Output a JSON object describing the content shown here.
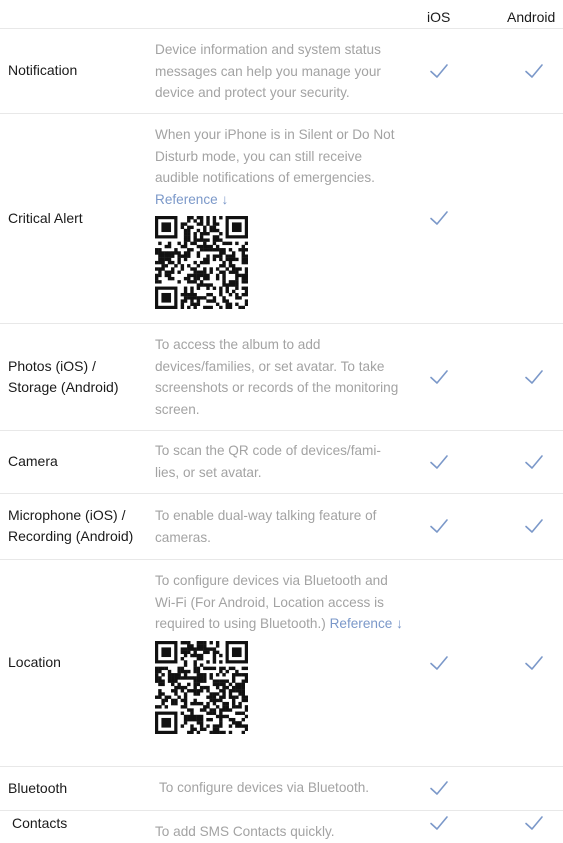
{
  "columns": {
    "ios": "iOS",
    "android": "Android"
  },
  "reference_label": "Reference",
  "reference_arrow": "↓",
  "colors": {
    "check": "#7b98c9",
    "text": "#1a1a1a",
    "description": "#a3a3a3",
    "divider": "#e8e8e8"
  },
  "rows": [
    {
      "feature": [
        "Notification"
      ],
      "description": "Device information and system status messages can help you manage your device and protect your security.",
      "ios": true,
      "android": true
    },
    {
      "feature": [
        "Critical Alert"
      ],
      "description": "When your iPhone is in Silent or Do Not Disturb mode, you can still receive audible notifications of emergencies.",
      "has_reference": true,
      "qr_code": "qr-code-critical-alert",
      "ios": true,
      "android": false
    },
    {
      "feature": [
        "Photos (iOS) /",
        "Storage (Android)"
      ],
      "description": "To access the album to add devices/families, or set avatar. To take screenshots or records of the monitoring screen.",
      "ios": true,
      "android": true
    },
    {
      "feature": [
        "Camera"
      ],
      "description": "To scan the QR code of devices/fami-lies, or set avatar.",
      "ios": true,
      "android": true
    },
    {
      "feature": [
        "Microphone (iOS) /",
        "Recording (Android)"
      ],
      "description": "To enable dual-way talking feature of cameras.",
      "ios": true,
      "android": true
    },
    {
      "feature": [
        "Location"
      ],
      "description": "To configure devices via Bluetooth and Wi-Fi (For Android, Location access is required to using Bluetooth.)",
      "has_reference": true,
      "qr_code": "qr-code-location",
      "ios": true,
      "android": true
    },
    {
      "feature": [
        "Bluetooth"
      ],
      "description": "To configure devices via Bluetooth.",
      "ios": true,
      "android": false
    },
    {
      "feature": [
        "Contacts"
      ],
      "description": "To add SMS Contacts quickly.",
      "ios": true,
      "android": true
    }
  ]
}
